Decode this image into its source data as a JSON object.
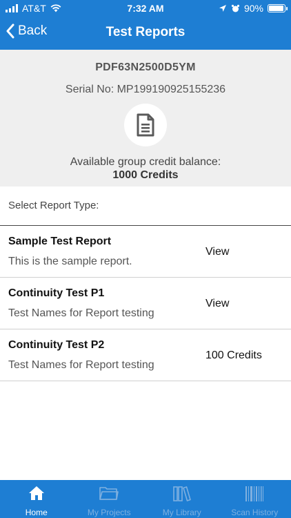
{
  "status_bar": {
    "carrier": "AT&T",
    "time": "7:32 AM",
    "battery": "90%",
    "battery_level": 0.9
  },
  "nav": {
    "back_label": "Back",
    "title": "Test Reports"
  },
  "device": {
    "id": "PDF63N2500D5YM",
    "serial": "Serial No: MP199190925155236"
  },
  "credits": {
    "label": "Available group credit balance:",
    "value": "1000  Credits"
  },
  "select_label": "Select Report Type:",
  "reports": [
    {
      "name": "Sample Test Report",
      "description": "This is the sample report.",
      "action": "View"
    },
    {
      "name": "Continuity Test P1",
      "description": "Test Names for Report testing",
      "action": "View"
    },
    {
      "name": "Continuity Test P2",
      "description": "Test Names for Report testing",
      "action": "100 Credits"
    }
  ],
  "tabs": [
    {
      "label": "Home",
      "icon": "home-icon",
      "active": true
    },
    {
      "label": "My Projects",
      "icon": "folder-icon",
      "active": false
    },
    {
      "label": "My Library",
      "icon": "library-icon",
      "active": false
    },
    {
      "label": "Scan History",
      "icon": "barcode-icon",
      "active": false
    }
  ],
  "colors": {
    "primary": "#1e7ed3",
    "summary_bg": "#efefef",
    "tab_inactive": "#7fb0e0"
  }
}
